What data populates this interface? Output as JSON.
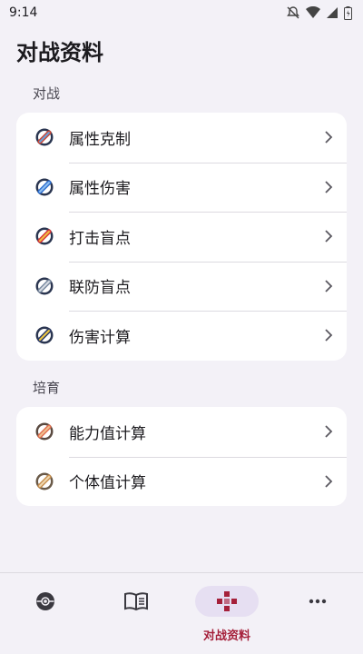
{
  "status": {
    "time": "9:14"
  },
  "page": {
    "title": "对战资料"
  },
  "sections": [
    {
      "title": "对战",
      "items": [
        {
          "label": "属性克制",
          "icon": "ball-icon",
          "color": "#c8483a"
        },
        {
          "label": "属性伤害",
          "icon": "ball-icon",
          "color": "#2f6fd0"
        },
        {
          "label": "打击盲点",
          "icon": "ball-icon",
          "color": "#e0a020"
        },
        {
          "label": "联防盲点",
          "icon": "ball-icon",
          "color": "#5a6e8c"
        },
        {
          "label": "伤害计算",
          "icon": "ball-icon",
          "color": "#2d3a66"
        }
      ]
    },
    {
      "title": "培育",
      "items": [
        {
          "label": "能力值计算",
          "icon": "ball-icon",
          "color": "#e07050"
        },
        {
          "label": "个体值计算",
          "icon": "ball-icon",
          "color": "#c89050"
        }
      ]
    }
  ],
  "nav": [
    {
      "name": "pokeball-icon",
      "label": ""
    },
    {
      "name": "book-icon",
      "label": ""
    },
    {
      "name": "battle-icon",
      "label": "对战资料",
      "active": true
    },
    {
      "name": "more-icon",
      "label": ""
    }
  ],
  "accent": "#a5203a"
}
